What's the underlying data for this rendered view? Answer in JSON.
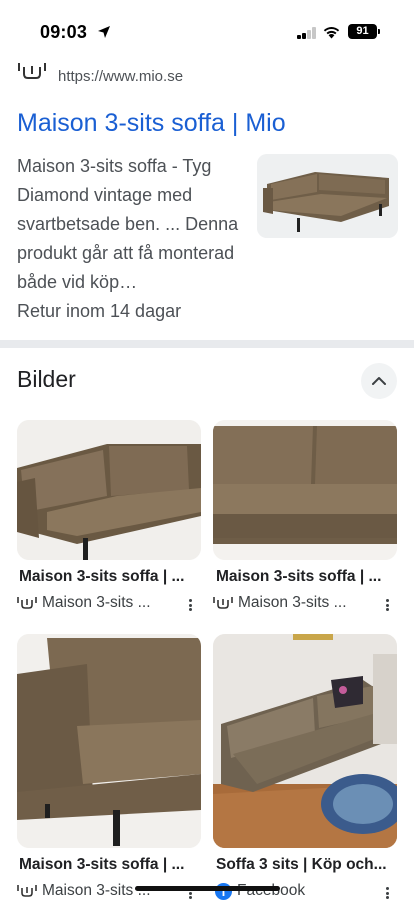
{
  "status_bar": {
    "time": "09:03",
    "battery": "91"
  },
  "result": {
    "url": "https://www.mio.se",
    "title": "Maison 3-sits soffa | Mio",
    "snippet": "Maison 3-sits soffa - Tyg Diamond vintage med svartbetsade ben. ... Denna produkt går att få monterad både vid köp…",
    "return_note": "Retur inom 14 dagar"
  },
  "images_section": {
    "title": "Bilder",
    "cards": [
      {
        "title": "Maison 3-sits soffa | ...",
        "source": "Maison 3-sits ..."
      },
      {
        "title": "Maison 3-sits soffa | ...",
        "source": "Maison 3-sits ..."
      },
      {
        "title": "Maison 3-sits soffa | ...",
        "source": "Maison 3-sits ..."
      },
      {
        "title": "Soffa 3 sits | Köp och...",
        "source": "Facebook"
      }
    ]
  },
  "colors": {
    "link": "#1a5fd3",
    "sofa": "#7d6a52",
    "divider": "#e8eaed"
  },
  "icons": [
    "location-arrow-icon",
    "signal-icon",
    "wifi-icon",
    "battery-icon",
    "mio-logo-icon",
    "chevron-up-icon",
    "more-vert-icon",
    "facebook-icon"
  ]
}
